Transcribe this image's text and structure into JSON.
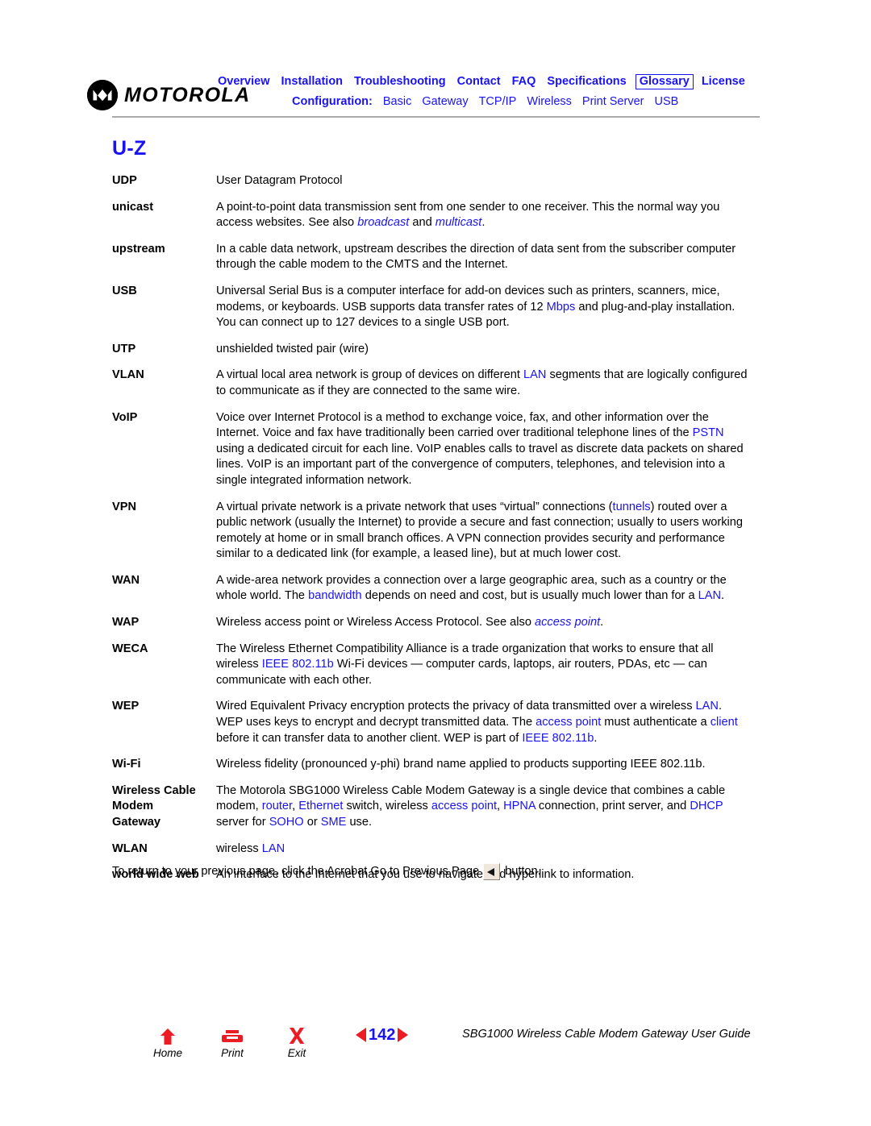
{
  "header": {
    "logo_text": "MOTOROLA",
    "logo_icon": "motorola-batwing-logo",
    "nav_primary": [
      {
        "label": "Overview",
        "boxed": false
      },
      {
        "label": "Installation",
        "boxed": false
      },
      {
        "label": "Troubleshooting",
        "boxed": false
      },
      {
        "label": "Contact",
        "boxed": false
      },
      {
        "label": "FAQ",
        "boxed": false
      },
      {
        "label": "Specifications",
        "boxed": false
      },
      {
        "label": "Glossary",
        "boxed": true
      },
      {
        "label": "License",
        "boxed": false
      }
    ],
    "config_label": "Configuration:",
    "nav_config": [
      {
        "label": "Basic"
      },
      {
        "label": "Gateway"
      },
      {
        "label": "TCP/IP"
      },
      {
        "label": "Wireless"
      },
      {
        "label": "Print Server"
      },
      {
        "label": "USB"
      }
    ]
  },
  "page_title": "U-Z",
  "glossary": [
    {
      "term": [
        "UDP"
      ],
      "def": [
        [
          {
            "t": "User Datagram Protocol",
            "s": "plain"
          }
        ]
      ]
    },
    {
      "term": [
        "unicast"
      ],
      "def": [
        [
          {
            "t": "A point-to-point data transmission sent from one sender to one receiver. This the normal way you",
            "s": "plain"
          }
        ],
        [
          {
            "t": "access websites. See also ",
            "s": "plain"
          },
          {
            "t": "broadcast",
            "s": "link-italic"
          },
          {
            "t": " and ",
            "s": "plain"
          },
          {
            "t": "multicast",
            "s": "link-italic"
          },
          {
            "t": ".",
            "s": "plain"
          }
        ]
      ]
    },
    {
      "term": [
        "upstream"
      ],
      "def": [
        [
          {
            "t": "In a cable data network, upstream describes the direction of data sent from the subscriber computer",
            "s": "plain"
          }
        ],
        [
          {
            "t": "through the cable modem to the CMTS and the Internet.",
            "s": "plain"
          }
        ]
      ]
    },
    {
      "term": [
        "USB"
      ],
      "def": [
        [
          {
            "t": "Universal Serial Bus is a computer interface for add-on devices such as printers, scanners, mice,",
            "s": "plain"
          }
        ],
        [
          {
            "t": "modems, or keyboards. USB supports data transfer rates of 12 ",
            "s": "plain"
          },
          {
            "t": "Mbps",
            "s": "link"
          },
          {
            "t": " and plug-and-play installation.",
            "s": "plain"
          }
        ],
        [
          {
            "t": "You can connect up to 127 devices to a single USB port.",
            "s": "plain"
          }
        ]
      ]
    },
    {
      "term": [
        "UTP"
      ],
      "def": [
        [
          {
            "t": "unshielded twisted pair (wire)",
            "s": "plain"
          }
        ]
      ]
    },
    {
      "term": [
        "VLAN"
      ],
      "def": [
        [
          {
            "t": "A virtual local area network is group of devices on different ",
            "s": "plain"
          },
          {
            "t": "LAN",
            "s": "link"
          },
          {
            "t": " segments that are logically configured",
            "s": "plain"
          }
        ],
        [
          {
            "t": "to communicate as if they are connected to the same wire.",
            "s": "plain"
          }
        ]
      ]
    },
    {
      "term": [
        "VoIP"
      ],
      "def": [
        [
          {
            "t": "Voice over Internet Protocol is a method to exchange voice, fax, and other information over the",
            "s": "plain"
          }
        ],
        [
          {
            "t": "Internet. Voice and fax have traditionally been carried over traditional telephone lines of the ",
            "s": "plain"
          },
          {
            "t": "PSTN",
            "s": "link"
          }
        ],
        [
          {
            "t": "using a dedicated circuit for each line. VoIP enables calls to travel as discrete data packets on shared",
            "s": "plain"
          }
        ],
        [
          {
            "t": "lines. VoIP is an important part of the convergence of computers, telephones, and television into a",
            "s": "plain"
          }
        ],
        [
          {
            "t": "single integrated information network.",
            "s": "plain"
          }
        ]
      ]
    },
    {
      "term": [
        "VPN"
      ],
      "def": [
        [
          {
            "t": "A virtual private network is a private network that uses “virtual” connections (",
            "s": "plain"
          },
          {
            "t": "tunnels",
            "s": "link"
          },
          {
            "t": ") routed over a",
            "s": "plain"
          }
        ],
        [
          {
            "t": "public network (usually the Internet) to provide a secure and fast connection; usually to users working",
            "s": "plain"
          }
        ],
        [
          {
            "t": "remotely at home or in small branch offices. A VPN connection provides security and performance",
            "s": "plain"
          }
        ],
        [
          {
            "t": "similar to a dedicated link (for example, a leased line), but at much lower cost.",
            "s": "plain"
          }
        ]
      ]
    },
    {
      "term": [
        "WAN"
      ],
      "def": [
        [
          {
            "t": "A wide-area network provides a connection over a large geographic area, such as a country or the",
            "s": "plain"
          }
        ],
        [
          {
            "t": "whole world. The ",
            "s": "plain"
          },
          {
            "t": "bandwidth",
            "s": "link"
          },
          {
            "t": " depends on need and cost, but is usually much lower than for a ",
            "s": "plain"
          },
          {
            "t": "LAN",
            "s": "link"
          },
          {
            "t": ".",
            "s": "plain"
          }
        ]
      ]
    },
    {
      "term": [
        "WAP"
      ],
      "def": [
        [
          {
            "t": "Wireless access point or Wireless Access Protocol. See also ",
            "s": "plain"
          },
          {
            "t": "access point",
            "s": "link-italic"
          },
          {
            "t": ".",
            "s": "plain"
          }
        ]
      ]
    },
    {
      "term": [
        "WECA"
      ],
      "def": [
        [
          {
            "t": "The Wireless Ethernet Compatibility Alliance is a trade organization that works to ensure that all",
            "s": "plain"
          }
        ],
        [
          {
            "t": "wireless ",
            "s": "plain"
          },
          {
            "t": "IEEE 802.11b",
            "s": "link"
          },
          {
            "t": " Wi-Fi devices — computer cards, laptops, air routers, PDAs, etc — can",
            "s": "plain"
          }
        ],
        [
          {
            "t": "communicate with each other.",
            "s": "plain"
          }
        ]
      ]
    },
    {
      "term": [
        "WEP"
      ],
      "def": [
        [
          {
            "t": "Wired Equivalent Privacy encryption protects the privacy of data transmitted over a wireless ",
            "s": "plain"
          },
          {
            "t": "LAN",
            "s": "link"
          },
          {
            "t": ".",
            "s": "plain"
          }
        ],
        [
          {
            "t": "WEP uses keys to encrypt and decrypt transmitted data. The ",
            "s": "plain"
          },
          {
            "t": "access point",
            "s": "link"
          },
          {
            "t": " must authenticate a ",
            "s": "plain"
          },
          {
            "t": "client",
            "s": "link"
          }
        ],
        [
          {
            "t": "before it can transfer data to another client. WEP is part of ",
            "s": "plain"
          },
          {
            "t": "IEEE 802.11b",
            "s": "link"
          },
          {
            "t": ".",
            "s": "plain"
          }
        ]
      ]
    },
    {
      "term": [
        "Wi-Fi"
      ],
      "def": [
        [
          {
            "t": "Wireless fidelity (pronounced y-phi) brand name applied to products supporting IEEE 802.11b.",
            "s": "plain"
          }
        ]
      ]
    },
    {
      "term": [
        "Wireless Cable",
        "Modem",
        "Gateway"
      ],
      "def": [
        [
          {
            "t": "The Motorola SBG1000 Wireless Cable Modem Gateway is a single device that combines a cable",
            "s": "plain"
          }
        ],
        [
          {
            "t": "modem, ",
            "s": "plain"
          },
          {
            "t": "router",
            "s": "link"
          },
          {
            "t": ", ",
            "s": "plain"
          },
          {
            "t": "Ethernet",
            "s": "link"
          },
          {
            "t": " switch, wireless ",
            "s": "plain"
          },
          {
            "t": "access point",
            "s": "link"
          },
          {
            "t": ", ",
            "s": "plain"
          },
          {
            "t": "HPNA",
            "s": "link"
          },
          {
            "t": " connection, print server, and ",
            "s": "plain"
          },
          {
            "t": "DHCP",
            "s": "link"
          }
        ],
        [
          {
            "t": "server for ",
            "s": "plain"
          },
          {
            "t": "SOHO",
            "s": "link"
          },
          {
            "t": " or ",
            "s": "plain"
          },
          {
            "t": "SME",
            "s": "link"
          },
          {
            "t": " use.",
            "s": "plain"
          }
        ]
      ]
    },
    {
      "term": [
        "WLAN"
      ],
      "def": [
        [
          {
            "t": "wireless ",
            "s": "plain"
          },
          {
            "t": "LAN",
            "s": "link"
          }
        ]
      ]
    },
    {
      "term": [
        "world wide web"
      ],
      "def": [
        [
          {
            "t": "An interface to the Internet that you use to navigate and hyperlink to information.",
            "s": "plain"
          }
        ]
      ]
    }
  ],
  "return_note": {
    "before": "To return to your previous page, click the Acrobat Go to Previous Page",
    "icon": "go-to-previous-page-icon",
    "after": "button."
  },
  "footer": {
    "tools": [
      {
        "label": "Home",
        "icon": "home-icon"
      },
      {
        "label": "Print",
        "icon": "print-icon"
      },
      {
        "label": "Exit",
        "icon": "exit-x-icon"
      }
    ],
    "page_number": "142",
    "prev_icon": "prev-page-triangle-icon",
    "next_icon": "next-page-triangle-icon",
    "doc_title": "SBG1000 Wireless Cable Modem Gateway User Guide"
  },
  "colors": {
    "link_blue": "#1a13f0",
    "accent_red": "#ec1c24",
    "rule_gray": "#a9a9a9",
    "text_black": "#000000"
  }
}
